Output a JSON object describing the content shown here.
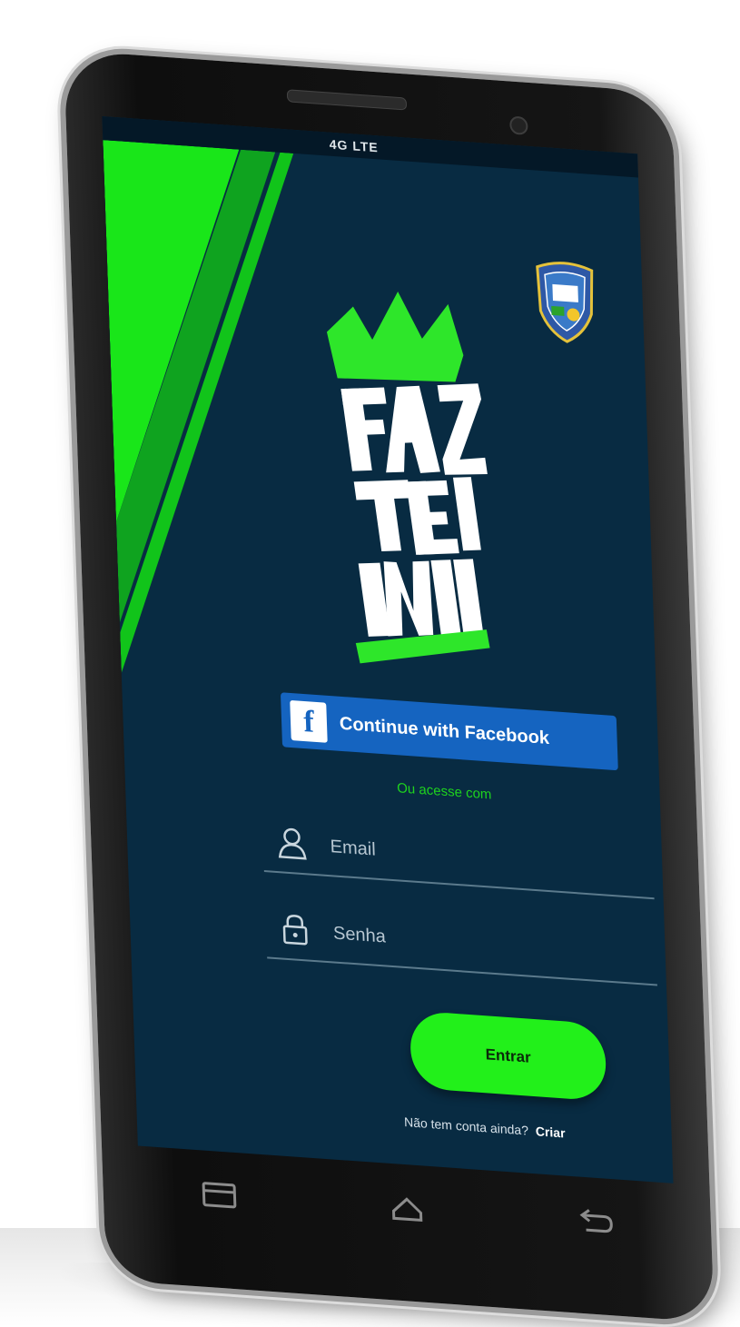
{
  "status_bar": {
    "network": "4G LTE"
  },
  "app": {
    "logo_icon": "faz-teu-nome-crown-logo",
    "badge_icon": "police-badge-icon"
  },
  "login": {
    "facebook_button_label": "Continue with Facebook",
    "or_text": "Ou acesse com",
    "email_placeholder": "Email",
    "password_placeholder": "Senha",
    "submit_label": "Entrar",
    "signup_prompt": "Não tem conta ainda?",
    "signup_link": "Criar"
  },
  "navigation": {
    "icons": [
      "recent-apps-icon",
      "home-icon",
      "back-icon"
    ]
  },
  "colors": {
    "background": "#082b42",
    "accent_green": "#22f01a",
    "facebook_blue": "#1564c0"
  }
}
